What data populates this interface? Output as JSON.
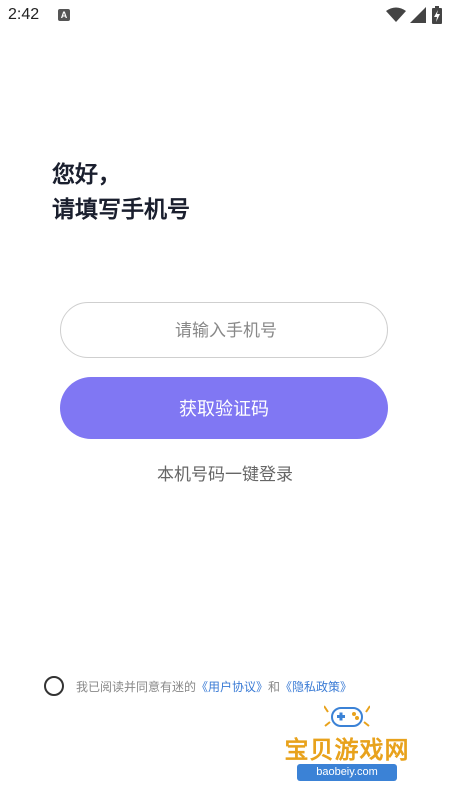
{
  "status_bar": {
    "time": "2:42",
    "notification_icon": "a-badge-icon",
    "wifi_icon": "wifi-icon",
    "signal_icon": "cell-signal-icon",
    "battery_icon": "battery-charging-icon"
  },
  "greeting": {
    "line1": "您好，",
    "line2": "请填写手机号"
  },
  "phone_input": {
    "value": "",
    "placeholder": "请输入手机号"
  },
  "get_code_button": {
    "label": "获取验证码"
  },
  "one_click_login": {
    "label": "本机号码一键登录"
  },
  "agreement": {
    "checked": false,
    "prefix": "我已阅读并同意有迷的",
    "user_agreement": "《用户协议》",
    "connector": "和",
    "privacy_policy": "《隐私政策》"
  },
  "watermark": {
    "title": "宝贝游戏网",
    "url": "baobeiy.com"
  },
  "colors": {
    "primary_button": "#8077f3",
    "link": "#3a7bd5",
    "watermark_orange": "#e8a21c",
    "watermark_blue": "#3b82d6"
  }
}
